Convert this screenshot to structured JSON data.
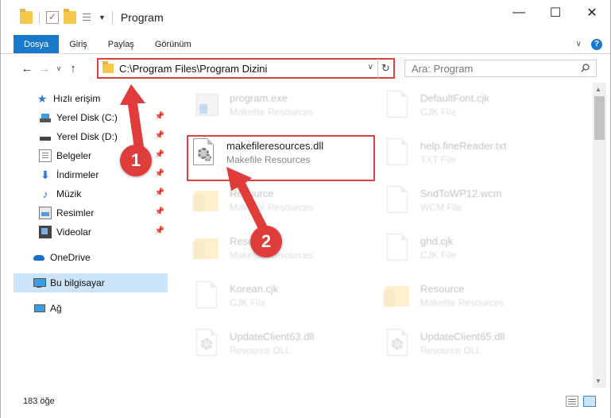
{
  "window": {
    "title": "Program",
    "controls": {
      "minimize": "—",
      "maximize": "☐",
      "close": "✕"
    }
  },
  "ribbon": {
    "tabs": [
      "Dosya",
      "Giriş",
      "Paylaş",
      "Görünüm"
    ],
    "expand_icon": "chevron-down-icon",
    "help_icon": "help-icon",
    "help_glyph": "?"
  },
  "navigation": {
    "address": "C:\\Program Files\\Program Dizini",
    "search_placeholder": "Ara: Program"
  },
  "sidebar": {
    "items": [
      {
        "label": "Hızlı erişim",
        "icon": "star-icon",
        "pinned": false
      },
      {
        "label": "Yerel Disk (C:)",
        "icon": "drive-icon",
        "pinned": true
      },
      {
        "label": "Yerel Disk (D:)",
        "icon": "drive-icon",
        "pinned": true
      },
      {
        "label": "Belgeler",
        "icon": "documents-icon",
        "pinned": true
      },
      {
        "label": "İndirmeler",
        "icon": "downloads-icon",
        "pinned": true
      },
      {
        "label": "Müzik",
        "icon": "music-icon",
        "pinned": true
      },
      {
        "label": "Resimler",
        "icon": "pictures-icon",
        "pinned": true
      },
      {
        "label": "Videolar",
        "icon": "videos-icon",
        "pinned": true
      },
      {
        "label": "OneDrive",
        "icon": "cloud-icon",
        "pinned": false
      },
      {
        "label": "Bu bilgisayar",
        "icon": "computer-icon",
        "pinned": false,
        "selected": true
      },
      {
        "label": "Ağ",
        "icon": "network-icon",
        "pinned": false
      }
    ]
  },
  "files": [
    {
      "name": "program.exe",
      "type": "Makefile Resources",
      "icon": "exe-icon",
      "faded": true
    },
    {
      "name": "DefaultFont.cjk",
      "type": "CJK File",
      "icon": "file-icon",
      "faded": true
    },
    {
      "name": "makefileresources.dll",
      "type": "Makefile Resources",
      "icon": "dll-gear-icon",
      "faded": false,
      "highlighted": true
    },
    {
      "name": "help.fineReader.txt",
      "type": "TXT File",
      "icon": "file-icon",
      "faded": true
    },
    {
      "name": "Resource",
      "type": "Makefile Resources",
      "icon": "folder-icon",
      "faded": true
    },
    {
      "name": "SndToWP12.wcm",
      "type": "WCM File",
      "icon": "file-icon",
      "faded": true
    },
    {
      "name": "Resource",
      "type": "Makefile Resources",
      "icon": "folder-icon",
      "faded": true
    },
    {
      "name": "ghd.cjk",
      "type": "CJK File",
      "icon": "file-icon",
      "faded": true
    },
    {
      "name": "Korean.cjk",
      "type": "CJK File",
      "icon": "file-icon",
      "faded": true
    },
    {
      "name": "Resource",
      "type": "Makefile Resources",
      "icon": "folder-icon",
      "faded": true
    },
    {
      "name": "UpdateClient63.dll",
      "type": "Resource DLL",
      "icon": "dll-gear-icon",
      "faded": true
    },
    {
      "name": "UpdateClient65.dll",
      "type": "Resource DLL",
      "icon": "dll-gear-icon",
      "faded": true
    }
  ],
  "status": {
    "item_count": "183 öğe"
  },
  "callouts": [
    {
      "number": "1",
      "target": "address-bar"
    },
    {
      "number": "2",
      "target": "makefileresources.dll"
    }
  ],
  "colors": {
    "accent": "#1979ca",
    "callout": "#e03c3c",
    "selection": "#cce4f7"
  }
}
